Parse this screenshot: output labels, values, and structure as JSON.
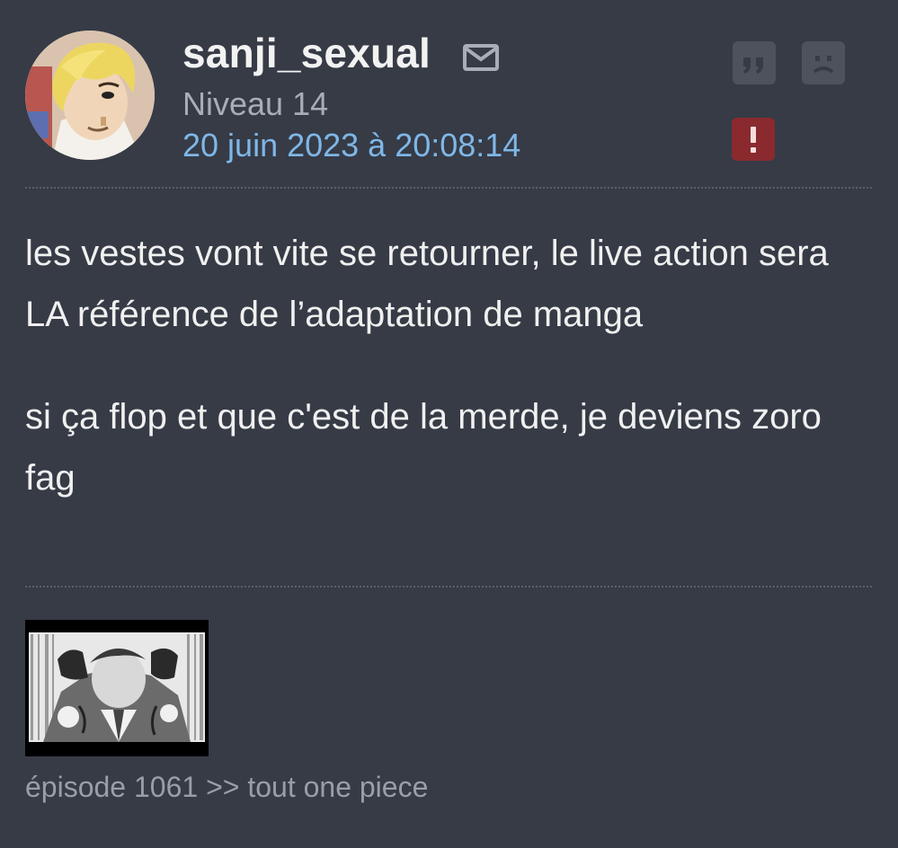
{
  "post": {
    "author": {
      "username": "sanji_sexual",
      "level": "Niveau 14",
      "avatar_icon": "avatar-image"
    },
    "date": "20 juin 2023 à 20:08:14",
    "actions": {
      "mail_icon": "mail-icon",
      "quote_icon": "quote-icon",
      "sad_icon": "sad-face-icon",
      "report_icon": "exclamation-icon"
    },
    "message": {
      "paragraphs": [
        "les vestes vont vite se retourner, le live action sera LA référence de l’adaptation de manga",
        "si ça flop et que c'est de la merde, je deviens zoro fag"
      ]
    },
    "signature": {
      "image_icon": "manga-panel-image",
      "text": "épisode 1061 >> tout one piece"
    },
    "colors": {
      "background": "#363b46",
      "username": "#f2f2f2",
      "level": "#a9adb6",
      "date": "#7fb7e6",
      "button": "#4d525c",
      "report_button": "#8a2a2e",
      "signature_text": "#9a9ea7"
    }
  }
}
